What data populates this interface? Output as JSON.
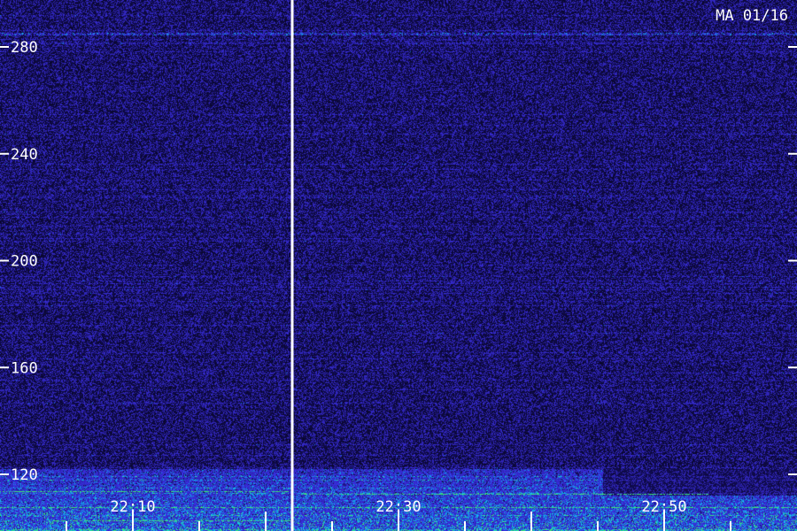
{
  "chart_data": {
    "type": "heatmap",
    "station_label": "MA 01/16",
    "y_tick_labels": [
      "280",
      "240",
      "200",
      "160",
      "120"
    ],
    "y_ticks": [
      280,
      240,
      200,
      160,
      120
    ],
    "ylim": [
      100,
      295
    ],
    "x_tick_labels": [
      "22:10",
      "22:30",
      "22:50"
    ],
    "x_ticks_minutes": [
      10,
      30,
      50
    ],
    "xlim_minutes": [
      0,
      60
    ],
    "minor_tick_interval_minutes": 5,
    "marker_line_minute": 22.0,
    "background_color": "#0a0830",
    "noise_color": "#2a20c8",
    "interference_color": "#20e060",
    "grid": false
  }
}
